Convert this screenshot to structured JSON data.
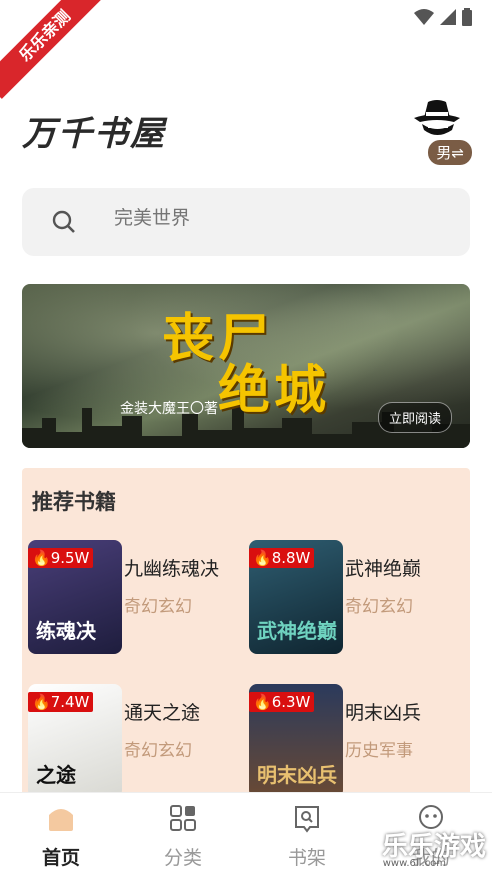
{
  "ribbon": "乐乐亲测",
  "header": {
    "logo": "万千书屋",
    "gender_badge": "男⇌"
  },
  "search": {
    "placeholder": "完美世界"
  },
  "banner": {
    "title_line1": "丧尸",
    "title_line2": "绝城",
    "author": "金装大魔王〇著",
    "read_button": "立即阅读"
  },
  "recommend": {
    "title": "推荐书籍",
    "books": [
      {
        "heat": "9.5W",
        "name": "九幽练魂决",
        "genre": "奇幻玄幻",
        "cover_text": "练魂决",
        "cover_color": "#2b2c5a"
      },
      {
        "heat": "8.8W",
        "name": "武神绝巅",
        "genre": "奇幻玄幻",
        "cover_text": "武神绝巅",
        "cover_color": "#1d3b4a"
      },
      {
        "heat": "7.4W",
        "name": "通天之途",
        "genre": "奇幻玄幻",
        "cover_text": "之途",
        "cover_color": "#f1f1ee"
      },
      {
        "heat": "6.3W",
        "name": "明末凶兵",
        "genre": "历史军事",
        "cover_text": "明末凶兵",
        "cover_color": "#3c3a45"
      }
    ]
  },
  "tabs": [
    {
      "label": "首页",
      "active": true
    },
    {
      "label": "分类",
      "active": false
    },
    {
      "label": "书架",
      "active": false
    },
    {
      "label": "我的",
      "active": false
    }
  ],
  "watermark": {
    "text": "乐乐游戏",
    "url": "www.6ll.com"
  },
  "colors": {
    "accent": "#f4c9a0",
    "panel": "#fbe6d8",
    "heat": "#d90f0f",
    "genre": "#c29a7b"
  }
}
